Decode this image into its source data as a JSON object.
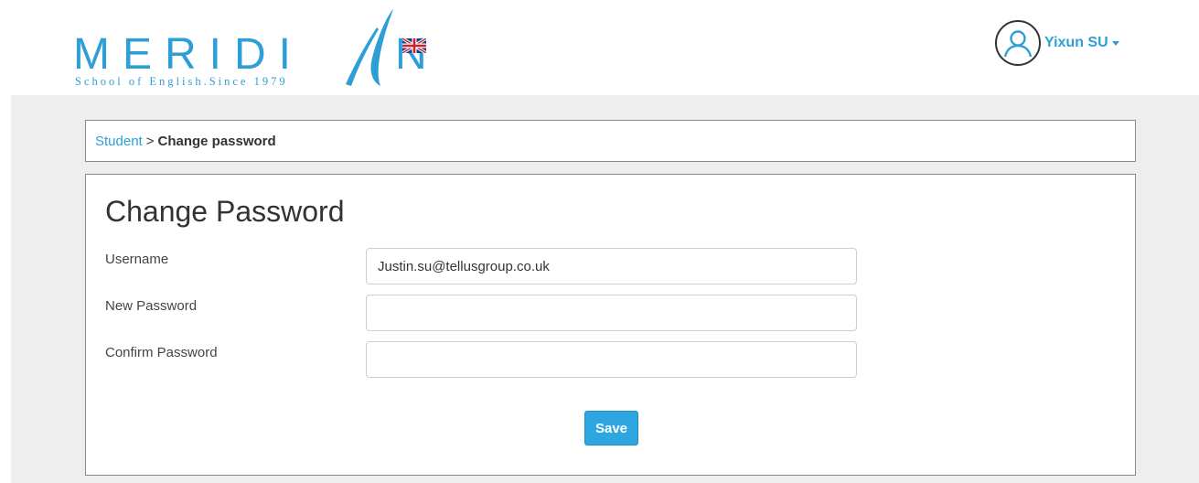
{
  "brand": {
    "word": "MERIDI",
    "word_end": "N",
    "tagline": "School of English.Since 1979",
    "flag_icon": "uk-flag-icon",
    "color": "#2d9fd6"
  },
  "user": {
    "name": "Yixun SU",
    "avatar_icon": "user-avatar-icon",
    "caret_icon": "caret-down-icon"
  },
  "breadcrumb": {
    "parent": "Student",
    "separator": ">",
    "current": "Change password"
  },
  "form": {
    "title": "Change Password",
    "username_label": "Username",
    "username_value": "Justin.su@tellusgroup.co.uk",
    "new_password_label": "New Password",
    "new_password_value": "",
    "confirm_password_label": "Confirm Password",
    "confirm_password_value": "",
    "save_label": "Save"
  },
  "colors": {
    "accent": "#2d9fd6",
    "button": "#2ea7e0",
    "page_bg": "#eeeeee"
  }
}
